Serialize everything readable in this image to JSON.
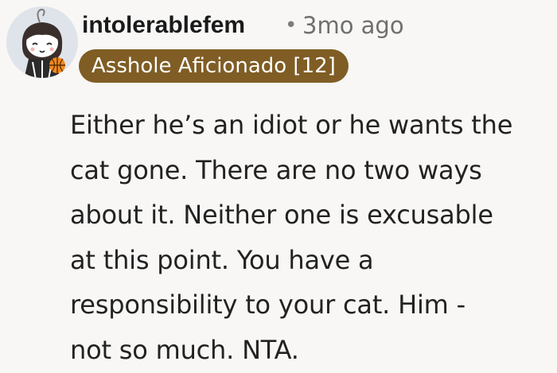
{
  "comment": {
    "avatar_icon": "user-avatar-chibi-with-basketball",
    "username": "intolerablefem",
    "separator": "•",
    "timestamp": "3mo ago",
    "flair": "Asshole Aficionado [12]",
    "flair_color": "#7f5d24",
    "body_lines": [
      "Either he’s an idiot or he wants the",
      "cat gone. There are no two ways",
      "about it. Neither one is excusable",
      "at this point. You have a",
      "responsibility to your cat. Him -",
      "not so much. NTA."
    ]
  }
}
